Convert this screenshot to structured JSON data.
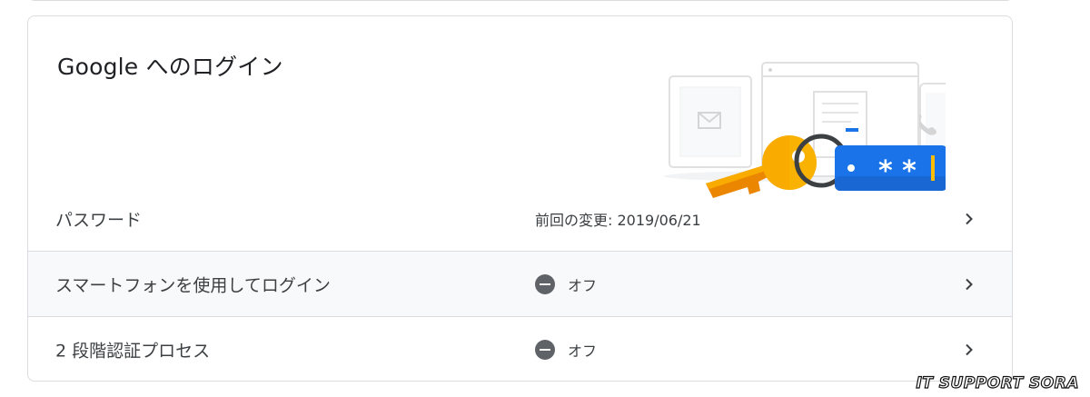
{
  "signin": {
    "title": "Google へのログイン",
    "rows": [
      {
        "label": "パスワード",
        "value": "前回の変更: 2019/06/21",
        "icon": ""
      },
      {
        "label": "スマートフォンを使用してログイン",
        "value": "オフ",
        "icon": "off-icon"
      },
      {
        "label": "2 段階認証プロセス",
        "value": "オフ",
        "icon": "off-icon"
      }
    ]
  },
  "illustration": {
    "password_mask": "* *"
  },
  "watermark": "IT SUPPORT SORA",
  "colors": {
    "divider": "#dadce0",
    "key_yellow": "#f9ab00",
    "key_orange": "#ea8600",
    "blue": "#1a73e8",
    "icon_gray": "#5f6368"
  }
}
